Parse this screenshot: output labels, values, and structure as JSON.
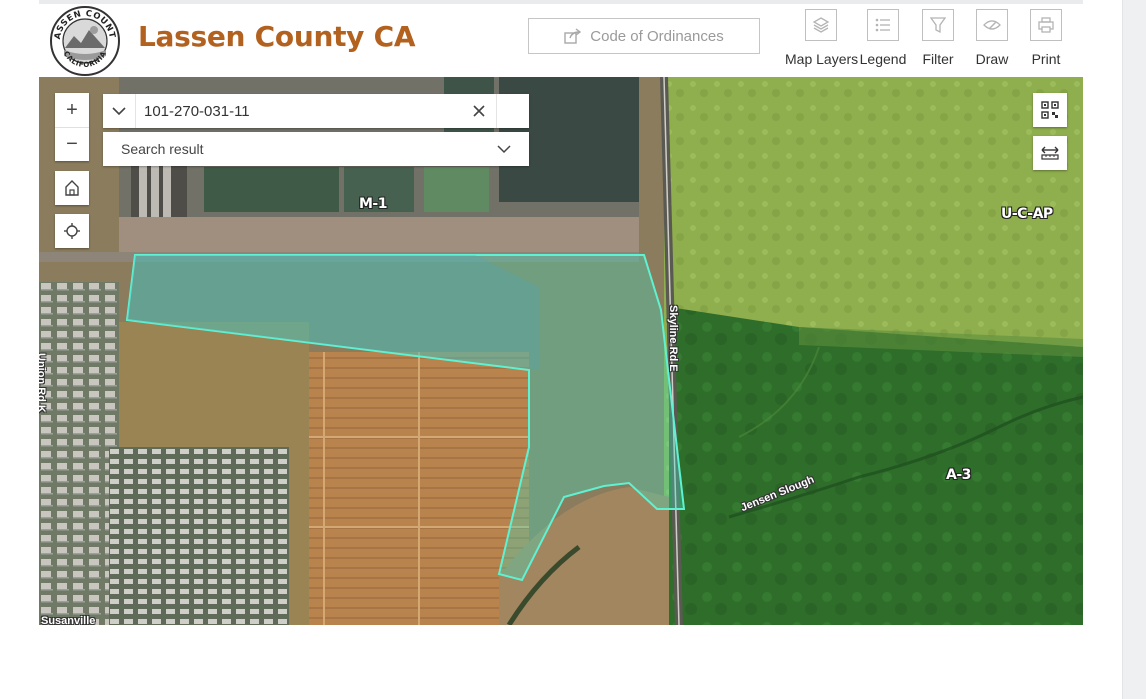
{
  "header": {
    "title": "Lassen County CA",
    "seal": {
      "top_text": "LASSEN COUNTY",
      "bottom_text": "CALIFORNIA"
    },
    "code_button_label": "Code of Ordinances",
    "tools": [
      {
        "label": "Map Layers",
        "icon": "layers-icon"
      },
      {
        "label": "Legend",
        "icon": "legend-icon"
      },
      {
        "label": "Filter",
        "icon": "filter-icon"
      },
      {
        "label": "Draw",
        "icon": "draw-icon"
      },
      {
        "label": "Print",
        "icon": "print-icon"
      }
    ]
  },
  "search": {
    "value": "101-270-031-11",
    "result_placeholder": "Search result"
  },
  "map": {
    "zoom_in": "+",
    "zoom_out": "−",
    "zones": [
      "M-1",
      "U-C-AP",
      "A-3"
    ],
    "roads": [
      "Skyline Rd E",
      "Union Rd K",
      "Jensen Slough",
      "Susanville"
    ],
    "parcel_color": "#3fe0c0"
  }
}
